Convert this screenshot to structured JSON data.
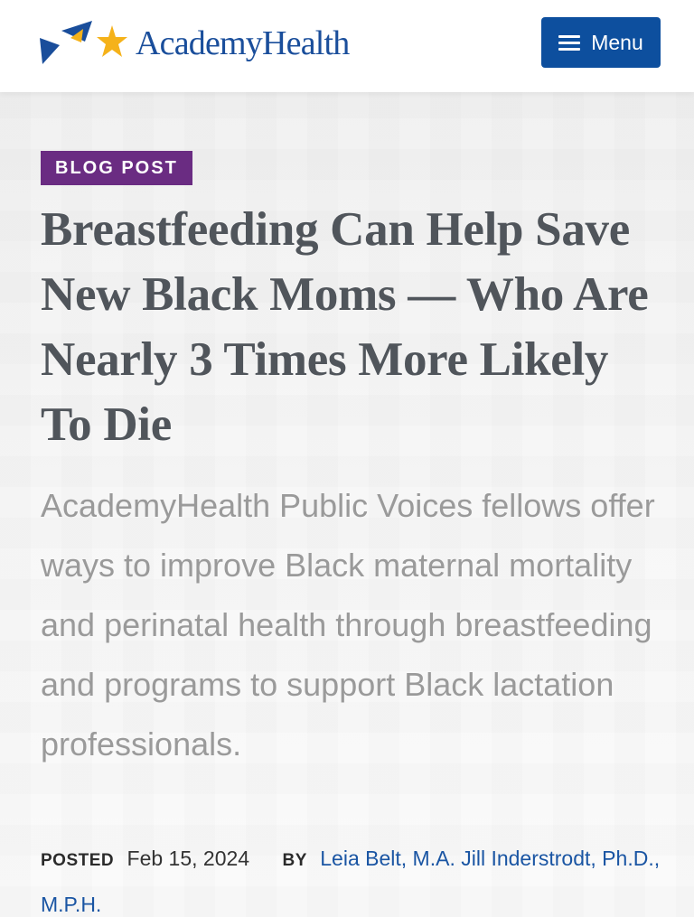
{
  "header": {
    "logo_text": "AcademyHealth",
    "menu_label": "Menu",
    "brand_colors": {
      "blue": "#1a4e9b",
      "gold": "#f5b21a",
      "button": "#0d4f9e"
    }
  },
  "article": {
    "badge": "BLOG POST",
    "badge_color": "#6a2c82",
    "title": "Breastfeeding Can Help Save New Black Moms — Who Are Nearly 3 Times More Likely To Die",
    "summary": "AcademyHealth Public Voices fellows offer ways to improve Black maternal mortality and perinatal health through breastfeeding and programs to support Black lactation professionals.",
    "posted_label": "POSTED",
    "posted_date": "Feb 15, 2024",
    "by_label": "BY",
    "authors": [
      {
        "name": "Leia Belt, M.A."
      },
      {
        "name": "Jill Inderstrodt, Ph.D., M.P.H."
      }
    ]
  },
  "icons": {
    "menu": "hamburger-icon",
    "logo": "star-logo-icon"
  }
}
